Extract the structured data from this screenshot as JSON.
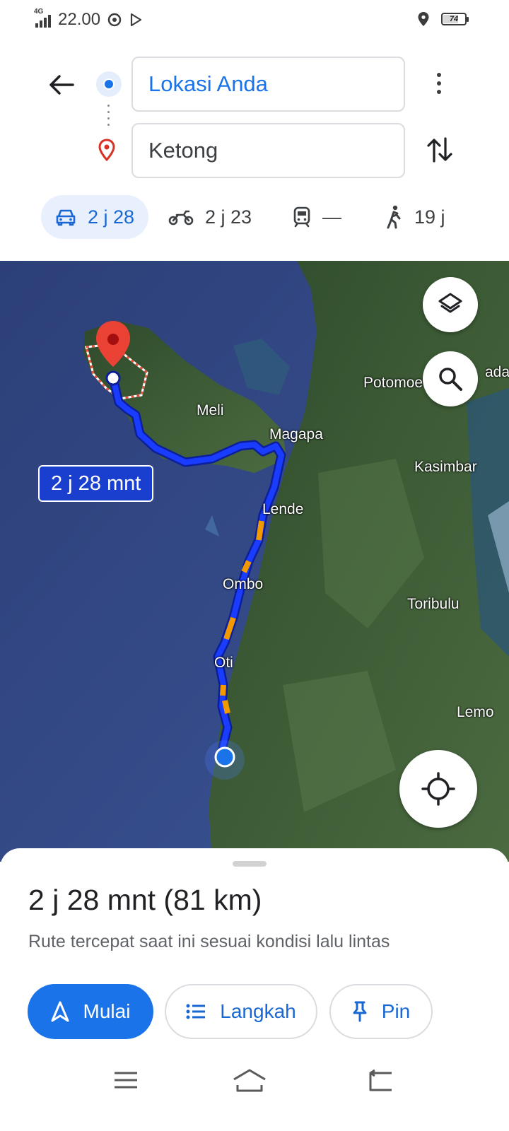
{
  "status_bar": {
    "network": "4G",
    "time": "22.00",
    "battery": "74",
    "battery_level_pct": 74
  },
  "search": {
    "origin_value": "Lokasi Anda",
    "destination_value": "Ketong"
  },
  "modes": [
    {
      "label": "2 j 28",
      "selected": true
    },
    {
      "label": "2 j 23",
      "selected": false
    },
    {
      "label": "—",
      "selected": false
    },
    {
      "label": "19 j",
      "selected": false
    }
  ],
  "map": {
    "eta_badge": "2 j 28 mnt",
    "place_labels": [
      "Meli",
      "Magapa",
      "Potomoe",
      "Kasimbar",
      "Lende",
      "Ombo",
      "Toribulu",
      "Oti",
      "Lemo"
    ],
    "truncated_label": "ada",
    "route_color": "#1a3cff",
    "traffic_color": "#f29900"
  },
  "sheet": {
    "summary": "2 j 28 mnt (81 km)",
    "subtitle": "Rute tercepat saat ini sesuai kondisi lalu lintas",
    "start_label": "Mulai",
    "steps_label": "Langkah",
    "pin_label": "Pin"
  },
  "colors": {
    "accent": "#1a73e8",
    "pin_red": "#ea4335"
  }
}
